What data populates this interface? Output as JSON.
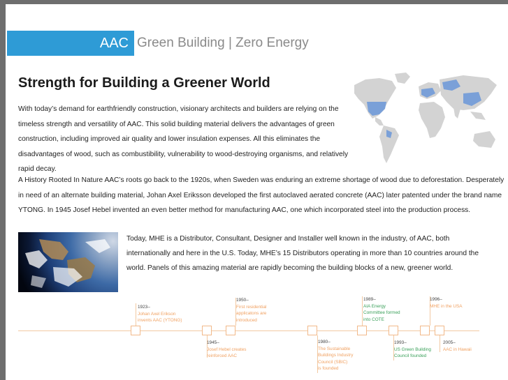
{
  "banner": {
    "tag": "AAC",
    "subtitle": "Green Building | Zero Energy"
  },
  "heading": "Strength for Building a Greener World",
  "paragraphs": [
    "With today’s demand for earthfriendly construction, visionary architects and builders are relying on the timeless strength and versatility of AAC. This solid building material delivers the advantages of green construction, including improved air quality and lower insulation expenses. All this eliminates the disadvantages of wood, such as combustibility, vulnerability to wood-destroying organisms, and relatively rapid decay.",
    "A History Rooted In Nature AAC’s roots go back to the 1920s, when Sweden was enduring an extreme shortage of wood due to deforestation. Desperately in need of an alternate building material, Johan Axel Eriksson developed the first autoclaved aerated concrete (AAC) later patented under the brand name YTONG. In 1945 Josef Hebel invented an even better method for manufacturing AAC, one which incorporated steel into the production process.",
    "Today, MHE is a Distributor, Consultant, Designer and Installer well known in the industry, of AAC, both internationally and here in the U.S. Today, MHE’s 15 Distributors operating in more than 10 countries around the world. Panels of this amazing material are rapidly becoming the building blocks of a new, greener world."
  ],
  "colors": {
    "accent": "#2e9bd6",
    "timeline_orange": "#f0a060",
    "timeline_green": "#3aa05a",
    "map_land": "#d3d3d3",
    "map_highlight": "#7aa0d8"
  },
  "timeline": {
    "e1923": {
      "year": "1923–",
      "l1": "Johan Axel Erikson",
      "l2": "invents AAC (YTONG)"
    },
    "e1945": {
      "year": "1945–",
      "l1": "Josef Hebel creates",
      "l2": "reinforced AAC"
    },
    "e1950": {
      "year": "1950–",
      "l1": "First residential",
      "l2": "applicatons are",
      "l3": "introduced"
    },
    "e1980": {
      "year": "1980–",
      "l1": "The Sustainable",
      "l2": "Buildings Industry",
      "l3": "Council (SBIC)",
      "l4": "is founded"
    },
    "e1989": {
      "year": "1989–",
      "l1": "AIA Energy",
      "l2": "Committee formed",
      "l3": "into COTE"
    },
    "e1993": {
      "year": "1993–",
      "l1": "US Green Building",
      "l2": "Council founded"
    },
    "e1996": {
      "year": "1996–",
      "l1": "MHE in the USA"
    },
    "e2005": {
      "year": "2005–",
      "l1": "AAC in Hawaii"
    }
  }
}
